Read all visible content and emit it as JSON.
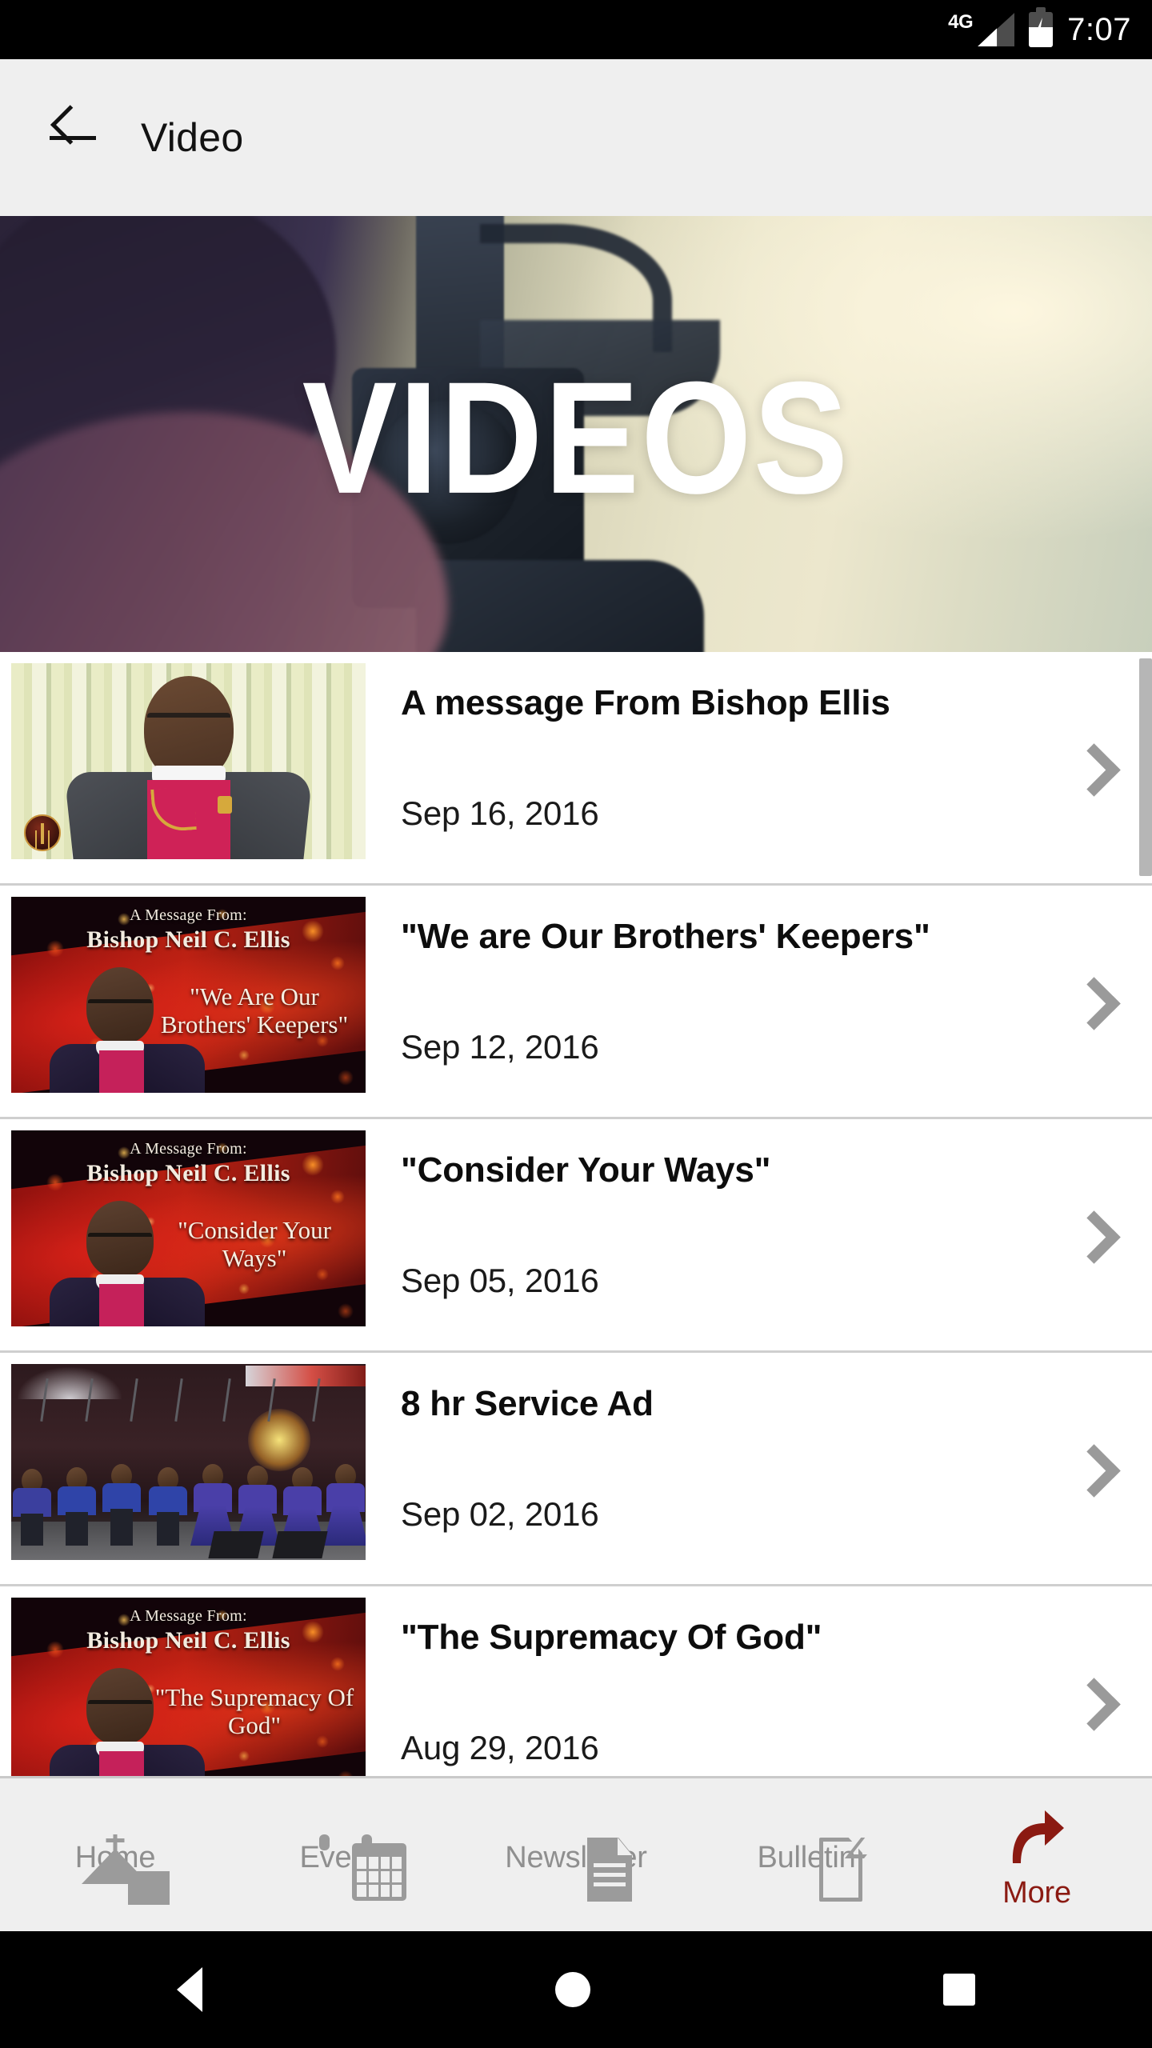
{
  "status_bar": {
    "network": "4G",
    "time": "7:07",
    "signal_icon": "signal-bars-icon",
    "battery_icon": "battery-charging-icon"
  },
  "app_bar": {
    "back_icon": "back-arrow-icon",
    "title": "Video"
  },
  "hero": {
    "word": "VIDEOS",
    "alt": "videographer operating a video camera"
  },
  "list": {
    "items": [
      {
        "title": "A message From Bishop Ellis",
        "date": "Sep 16, 2016",
        "thumb_style": "ellis-podium",
        "thumb_caption": "",
        "thumb_name": "",
        "thumb_quote": ""
      },
      {
        "title": "\"We are Our Brothers' Keepers\"",
        "date": "Sep 12, 2016",
        "thumb_style": "red-bokeh",
        "thumb_caption": "A Message From:",
        "thumb_name": "Bishop Neil C. Ellis",
        "thumb_quote": "\"We Are Our Brothers' Keepers\""
      },
      {
        "title": "\"Consider Your Ways\"",
        "date": "Sep 05, 2016",
        "thumb_style": "red-bokeh",
        "thumb_caption": "A Message From:",
        "thumb_name": "Bishop Neil C. Ellis",
        "thumb_quote": "\"Consider Your Ways\""
      },
      {
        "title": "8 hr Service Ad",
        "date": "Sep 02, 2016",
        "thumb_style": "choir-stage",
        "thumb_caption": "",
        "thumb_name": "",
        "thumb_quote": ""
      },
      {
        "title": "\"The Supremacy Of God\"",
        "date": "Aug 29, 2016",
        "thumb_style": "red-bokeh",
        "thumb_caption": "A Message From:",
        "thumb_name": "Bishop Neil C. Ellis",
        "thumb_quote": "\"The Supremacy Of God\""
      }
    ],
    "chevron_icon": "chevron-right-icon"
  },
  "tab_bar": {
    "active_color": "#8b1a12",
    "inactive_color": "#8f8f8f",
    "tabs": [
      {
        "label": "Home",
        "icon": "church-icon",
        "active": false
      },
      {
        "label": "Events",
        "icon": "calendar-icon",
        "active": false
      },
      {
        "label": "Newsletter",
        "icon": "document-lines-icon",
        "active": false
      },
      {
        "label": "Bulletin",
        "icon": "page-icon",
        "active": false
      },
      {
        "label": "More",
        "icon": "curved-arrow-icon",
        "active": true
      }
    ]
  },
  "system_nav": {
    "back_icon": "android-back-icon",
    "home_icon": "android-home-icon",
    "recents_icon": "android-recents-icon"
  }
}
